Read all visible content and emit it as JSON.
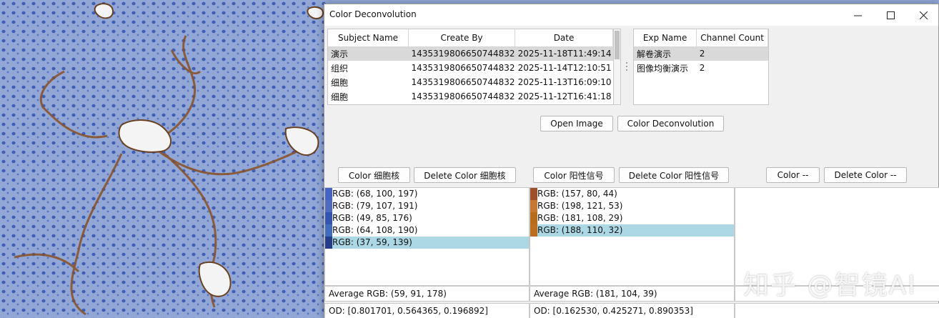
{
  "window": {
    "title": "Color Deconvolution"
  },
  "subject_table": {
    "headers": [
      "Subject Name",
      "Create By",
      "Date"
    ],
    "rows": [
      [
        "演示",
        "1435319806650744832",
        "2025-11-18T11:49:14"
      ],
      [
        "组织",
        "1435319806650744832",
        "2025-11-14T12:10:51"
      ],
      [
        "细胞",
        "1435319806650744832",
        "2025-11-13T16:09:10"
      ],
      [
        "细胞",
        "1435319806650744832",
        "2025-11-12T16:41:18"
      ]
    ],
    "selected_index": 0
  },
  "exp_table": {
    "headers": [
      "Exp Name",
      "Channel Count"
    ],
    "rows": [
      [
        "解卷演示",
        "2"
      ],
      [
        "图像均衡演示",
        "2"
      ]
    ],
    "selected_index": 0
  },
  "actions": {
    "open_image": "Open Image",
    "color_deconvolution": "Color Deconvolution"
  },
  "channels": [
    {
      "color_button": "Color 细胞核",
      "delete_button": "Delete Color 细胞核",
      "colors": [
        {
          "label": "RGB: (68, 100, 197)",
          "hex": "#4464c5"
        },
        {
          "label": "RGB: (79, 107, 191)",
          "hex": "#4f6bbf"
        },
        {
          "label": "RGB: (49, 85, 176)",
          "hex": "#3155b0"
        },
        {
          "label": "RGB: (64, 108, 190)",
          "hex": "#406cbe"
        },
        {
          "label": "RGB: (37, 59, 139)",
          "hex": "#253b8b"
        }
      ],
      "selected_index": 4,
      "average": "Average RGB: (59, 91, 178)",
      "od": "OD:   [0.801701, 0.564365, 0.196892]"
    },
    {
      "color_button": "Color 阳性信号",
      "delete_button": "Delete Color 阳性信号",
      "colors": [
        {
          "label": "RGB: (157, 80, 44)",
          "hex": "#9d502c"
        },
        {
          "label": "RGB: (198, 121, 53)",
          "hex": "#c67935"
        },
        {
          "label": "RGB: (181, 108, 29)",
          "hex": "#b56c1d"
        },
        {
          "label": "RGB: (188, 110, 32)",
          "hex": "#bc6e20"
        }
      ],
      "selected_index": 3,
      "average": "Average RGB: (181, 104, 39)",
      "od": "OD:   [0.162530, 0.425271, 0.890353]"
    },
    {
      "color_button": "Color --",
      "delete_button": "Delete Color --",
      "colors": [],
      "average": "",
      "od": ""
    }
  ],
  "watermark": "知乎 @智镜AI",
  "colors": {
    "selection_blue": "#acd8e6",
    "row_selected_gray": "#d9d9d9",
    "tissue_blue": "#8ea3d3"
  },
  "icons": [
    "minimize-icon",
    "maximize-icon",
    "close-icon",
    "splitter-grip-icon"
  ]
}
